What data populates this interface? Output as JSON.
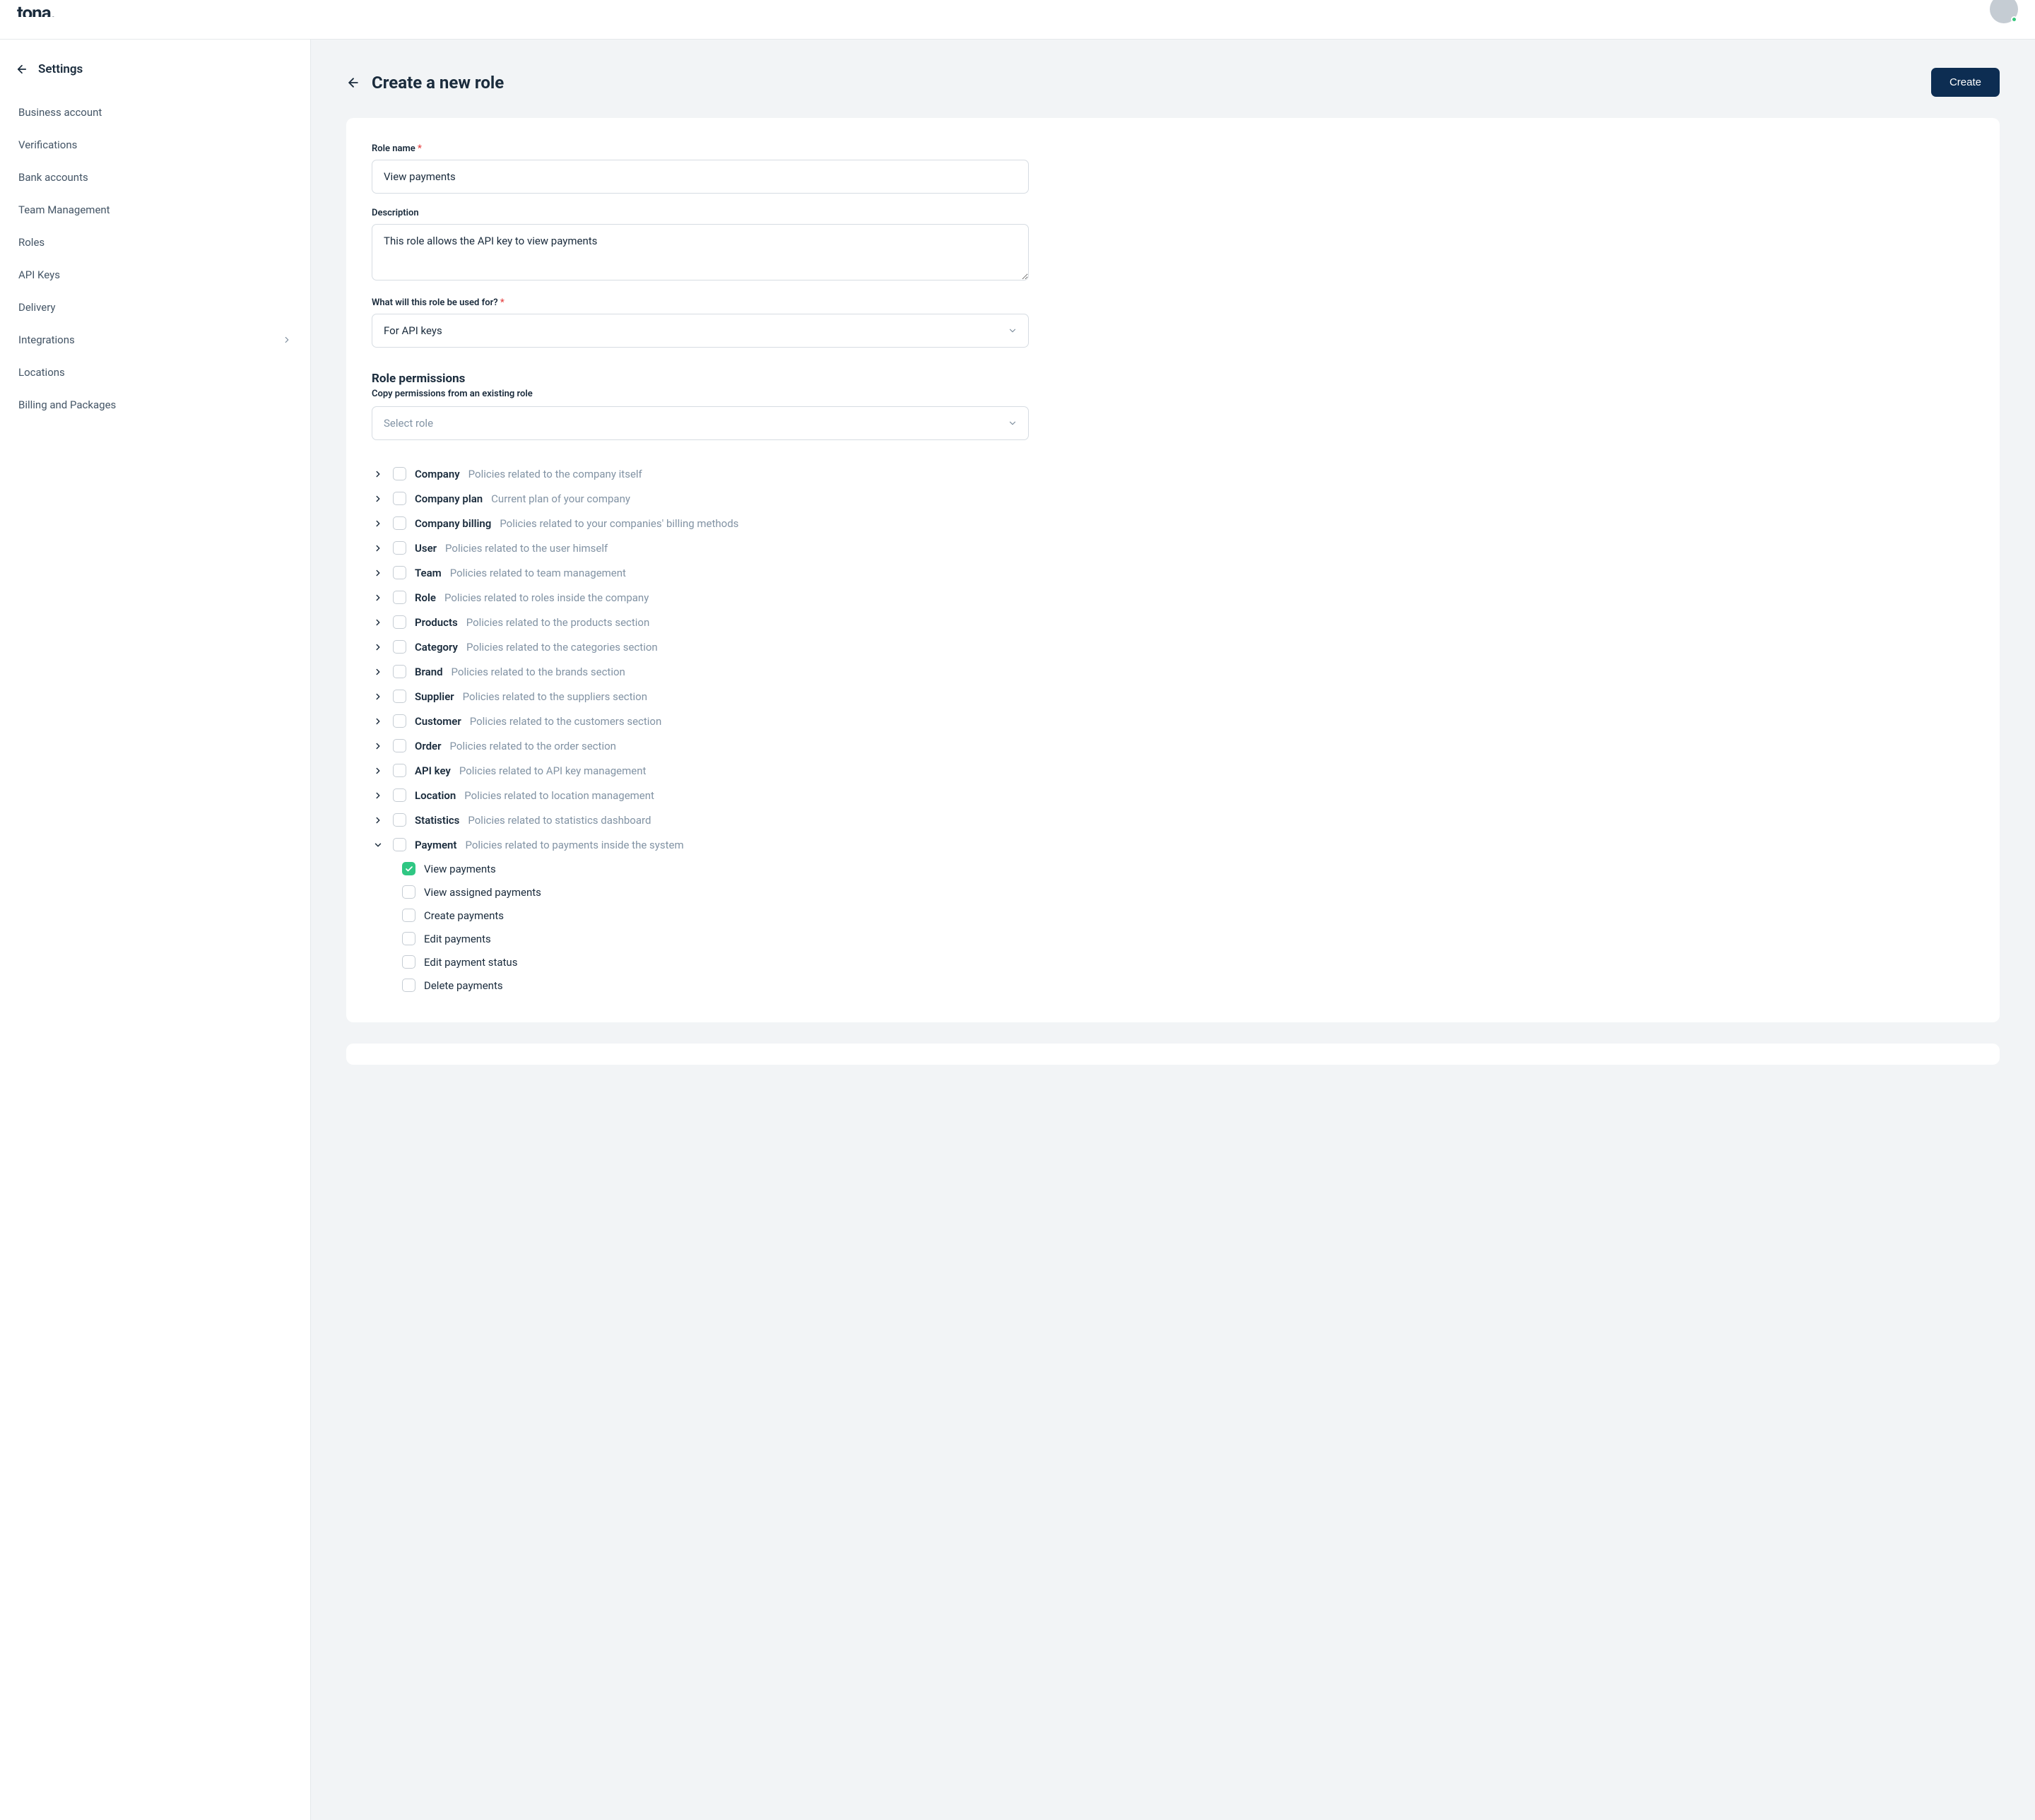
{
  "header": {
    "logo": "tona."
  },
  "sidebar": {
    "title": "Settings",
    "items": [
      {
        "label": "Business account"
      },
      {
        "label": "Verifications"
      },
      {
        "label": "Bank accounts"
      },
      {
        "label": "Team Management"
      },
      {
        "label": "Roles"
      },
      {
        "label": "API Keys"
      },
      {
        "label": "Delivery"
      },
      {
        "label": "Integrations",
        "chevron": true
      },
      {
        "label": "Locations"
      },
      {
        "label": "Billing and Packages"
      }
    ]
  },
  "page": {
    "title": "Create a new role",
    "create_btn": "Create"
  },
  "form": {
    "role_name_label": "Role name",
    "role_name_value": "View payments",
    "description_label": "Description",
    "description_value": "This role allows the API key to view payments",
    "usage_label": "What will this role be used for?",
    "usage_value": "For API keys",
    "permissions_heading": "Role permissions",
    "copy_label": "Copy permissions from an existing role",
    "copy_placeholder": "Select role"
  },
  "permissions": [
    {
      "name": "Company",
      "desc": "Policies related to the company itself"
    },
    {
      "name": "Company plan",
      "desc": "Current plan of your company"
    },
    {
      "name": "Company billing",
      "desc": "Policies related to your companies' billing methods"
    },
    {
      "name": "User",
      "desc": "Policies related to the user himself"
    },
    {
      "name": "Team",
      "desc": "Policies related to team management"
    },
    {
      "name": "Role",
      "desc": "Policies related to roles inside the company"
    },
    {
      "name": "Products",
      "desc": "Policies related to the products section"
    },
    {
      "name": "Category",
      "desc": "Policies related to the categories section"
    },
    {
      "name": "Brand",
      "desc": "Policies related to the brands section"
    },
    {
      "name": "Supplier",
      "desc": "Policies related to the suppliers section"
    },
    {
      "name": "Customer",
      "desc": "Policies related to the customers section"
    },
    {
      "name": "Order",
      "desc": "Policies related to the order section"
    },
    {
      "name": "API key",
      "desc": "Policies related to API key management"
    },
    {
      "name": "Location",
      "desc": "Policies related to location management"
    },
    {
      "name": "Statistics",
      "desc": "Policies related to statistics dashboard"
    },
    {
      "name": "Payment",
      "desc": "Policies related to payments inside the system",
      "expanded": true,
      "children": [
        {
          "label": "View payments",
          "checked": true
        },
        {
          "label": "View assigned payments",
          "checked": false
        },
        {
          "label": "Create payments",
          "checked": false
        },
        {
          "label": "Edit payments",
          "checked": false
        },
        {
          "label": "Edit payment status",
          "checked": false
        },
        {
          "label": "Delete payments",
          "checked": false
        }
      ]
    }
  ]
}
